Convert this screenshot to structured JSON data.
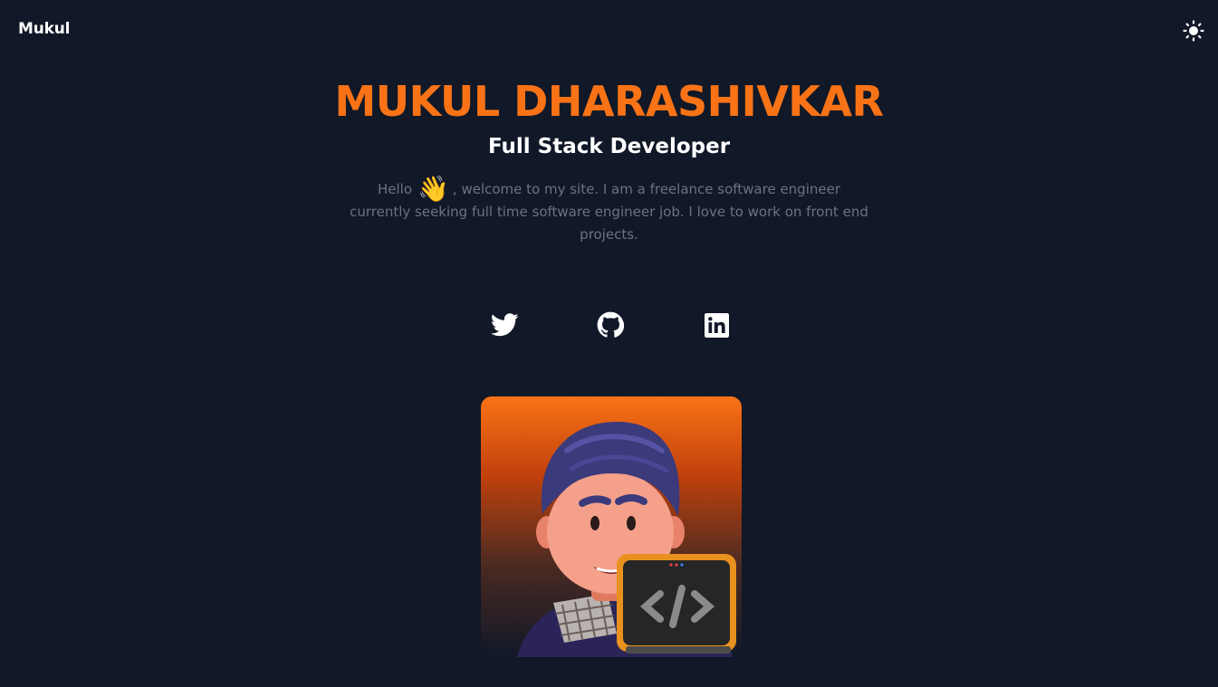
{
  "navbar": {
    "brand": "Mukul",
    "theme_toggle_icon": "sun-icon"
  },
  "hero": {
    "name": "MUKUL DHARASHIVKAR",
    "role": "Full Stack Developer",
    "intro_prefix": "Hello",
    "wave_emoji": "👋",
    "intro_rest": ", welcome to my site. I am a freelance software engineer currently seeking full time software engineer job. I love to work on front end projects."
  },
  "socials": [
    {
      "name": "Twitter",
      "icon": "twitter-icon"
    },
    {
      "name": "GitHub",
      "icon": "github-icon"
    },
    {
      "name": "LinkedIn",
      "icon": "linkedin-icon"
    }
  ],
  "avatar": {
    "description_icon": "developer-avatar"
  },
  "colors": {
    "background": "#111827",
    "accent": "#f97316",
    "muted_text": "#6b7280",
    "text": "#ffffff"
  }
}
